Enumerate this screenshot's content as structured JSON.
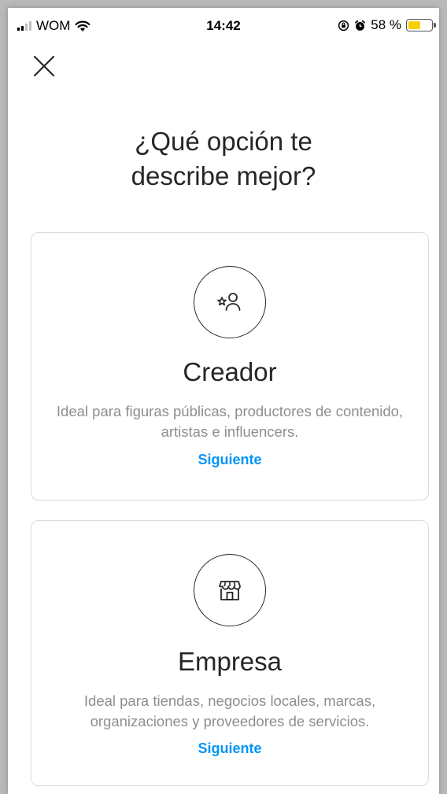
{
  "status_bar": {
    "carrier": "WOM",
    "time": "14:42",
    "battery": "58 %",
    "battery_level": 0.58
  },
  "header": {
    "title_line1": "¿Qué opción te",
    "title_line2": "describe mejor?"
  },
  "options": [
    {
      "icon": "creator-star-person-icon",
      "title": "Creador",
      "description": "Ideal para figuras públicas, productores de contenido, artistas e influencers.",
      "action": "Siguiente"
    },
    {
      "icon": "storefront-icon",
      "title": "Empresa",
      "description": "Ideal para tiendas, negocios locales, marcas, organizaciones y proveedores de servicios.",
      "action": "Siguiente"
    }
  ],
  "colors": {
    "link": "#0095f6",
    "text": "#262626",
    "secondary_text": "#8e8e8e",
    "border": "#dbdbdb",
    "battery": "#f6d000"
  }
}
